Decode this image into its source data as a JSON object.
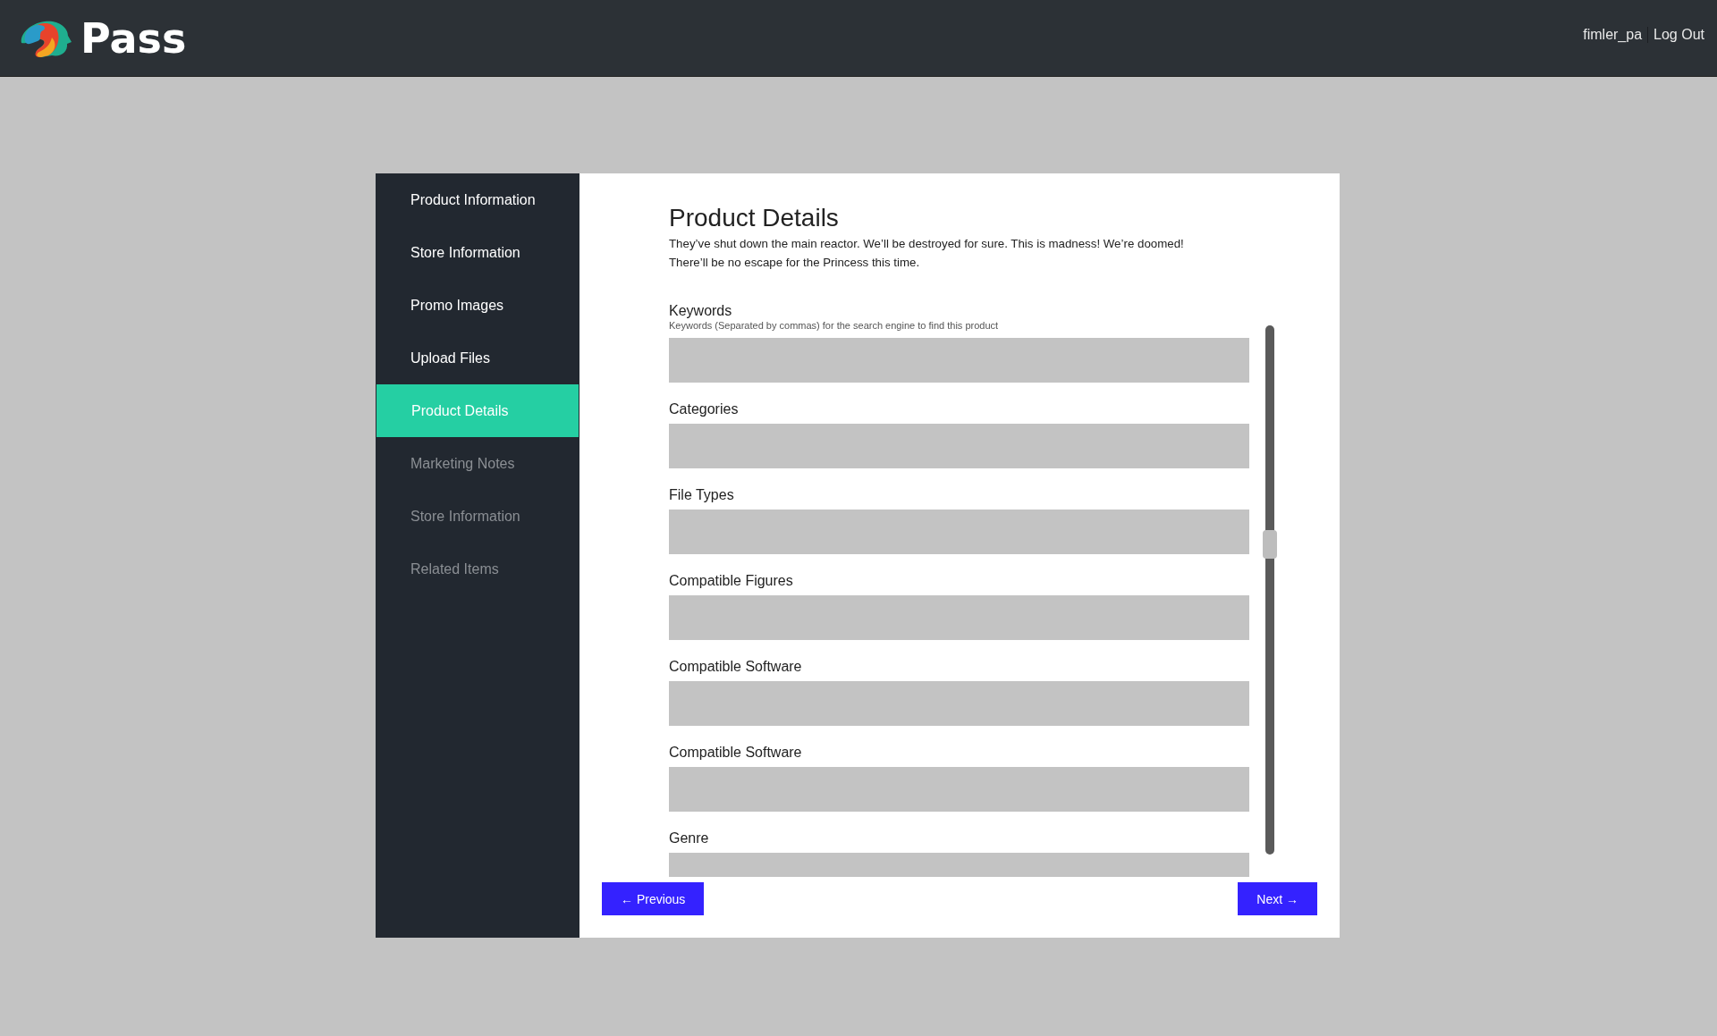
{
  "header": {
    "brand": "Pass",
    "username": "fimler_pa",
    "logout": "Log Out"
  },
  "sidebar": {
    "items": [
      {
        "label": "Product Information",
        "selected": false,
        "disabled": false
      },
      {
        "label": "Store Information",
        "selected": false,
        "disabled": false
      },
      {
        "label": "Promo Images",
        "selected": false,
        "disabled": false
      },
      {
        "label": "Upload Files",
        "selected": false,
        "disabled": false
      },
      {
        "label": "Product Details",
        "selected": true,
        "disabled": false
      },
      {
        "label": "Marketing Notes",
        "selected": false,
        "disabled": true
      },
      {
        "label": "Store Information",
        "selected": false,
        "disabled": true
      },
      {
        "label": "Related Items",
        "selected": false,
        "disabled": true
      }
    ]
  },
  "page": {
    "title": "Product Details",
    "description": "They’ve shut down the main reactor. We’ll be destroyed for sure. This is madness! We’re doomed! There’ll be no escape for the Princess this time."
  },
  "fields": [
    {
      "label": "Keywords",
      "hint": "Keywords (Separated by commas) for the search engine to find this product"
    },
    {
      "label": "Categories"
    },
    {
      "label": "File Types"
    },
    {
      "label": "Compatible Figures"
    },
    {
      "label": "Compatible Software"
    },
    {
      "label": "Compatible Software"
    },
    {
      "label": "Genre"
    }
  ],
  "buttons": {
    "previous": "← Previous",
    "next": "Next →"
  }
}
